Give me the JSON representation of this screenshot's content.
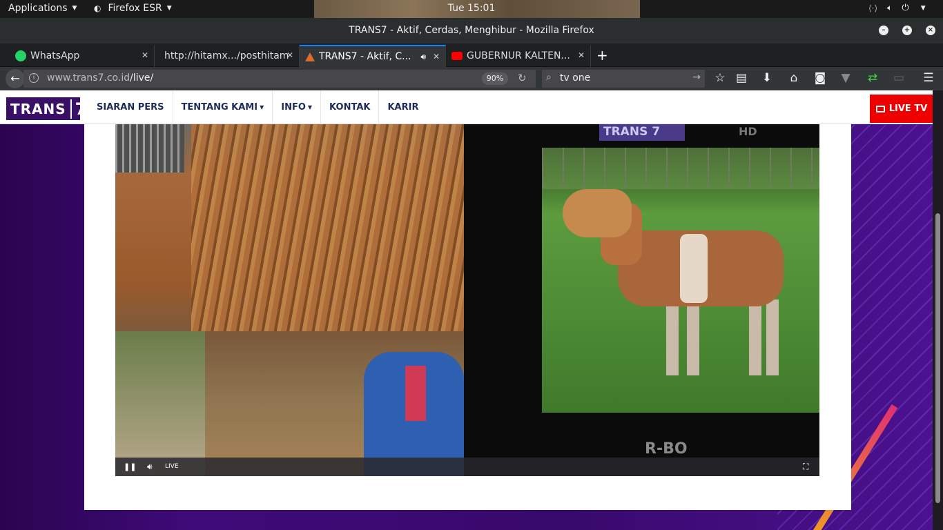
{
  "system_panel": {
    "applications": "Applications",
    "browser_app": "Firefox ESR",
    "clock": "Tue 15:01"
  },
  "window": {
    "title": "TRANS7 - Aktif, Cerdas, Menghibur - Mozilla Firefox"
  },
  "tabs": [
    {
      "label": "WhatsApp",
      "icon": "whatsapp-icon"
    },
    {
      "label": "http://hitamx.../posthitam/3",
      "icon": ""
    },
    {
      "label": "TRANS7 - Aktif, C...",
      "icon": "trans7-favicon",
      "active": true
    },
    {
      "label": "GUBERNUR KALTEN...",
      "icon": "youtube-icon"
    }
  ],
  "navbar": {
    "url_domain": "www.trans7.co.id",
    "url_path": "/live/",
    "zoom": "90%",
    "search_value": "tv one"
  },
  "site": {
    "logo_text": "TRANS",
    "logo_num": "7",
    "nav": [
      {
        "label": "SIARAN PERS",
        "dropdown": false
      },
      {
        "label": "TENTANG KAMI",
        "dropdown": true
      },
      {
        "label": "INFO",
        "dropdown": true
      },
      {
        "label": "KONTAK",
        "dropdown": false
      },
      {
        "label": "KARIR",
        "dropdown": false
      }
    ],
    "live_tv": "LIVE TV"
  },
  "video": {
    "overlay_logo": "TRANS 7",
    "overlay_hd": "HD",
    "caption": "R-BO",
    "live_label": "LIVE"
  },
  "colors": {
    "brand_purple": "#3a1066",
    "live_red": "#ee0000",
    "tab_accent": "#0a84ff"
  }
}
